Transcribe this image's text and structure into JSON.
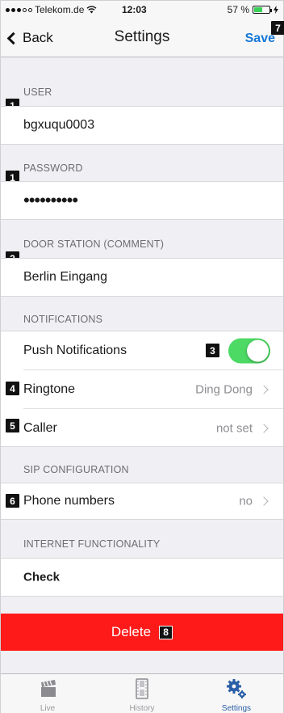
{
  "status_bar": {
    "carrier": "Telekom.de",
    "time": "12:03",
    "battery_text": "57 %",
    "battery_level": 0.57
  },
  "nav": {
    "back_label": "Back",
    "title": "Settings",
    "save_label": "Save"
  },
  "sections": {
    "user": {
      "header": "USER",
      "value": "bgxuqu0003",
      "badge": "1"
    },
    "password": {
      "header": "PASSWORD",
      "masked": "••••••••••",
      "badge": "1"
    },
    "door_station": {
      "header": "DOOR STATION (COMMENT)",
      "value": "Berlin Eingang",
      "badge": "2"
    },
    "notifications": {
      "header": "NOTIFICATIONS",
      "push": {
        "label": "Push Notifications",
        "enabled": true,
        "badge": "3"
      },
      "ringtone": {
        "label": "Ringtone",
        "value": "Ding Dong",
        "badge": "4"
      },
      "caller": {
        "label": "Caller",
        "value": "not set",
        "badge": "5"
      }
    },
    "sip": {
      "header": "SIP CONFIGURATION",
      "phone_numbers": {
        "label": "Phone numbers",
        "value": "no",
        "badge": "6"
      }
    },
    "internet": {
      "header": "INTERNET FUNCTIONALITY",
      "check_label": "Check"
    }
  },
  "delete": {
    "label": "Delete",
    "badge": "8"
  },
  "save_badge": "7",
  "tabs": [
    {
      "label": "Live",
      "icon": "clapperboard-icon"
    },
    {
      "label": "History",
      "icon": "film-icon"
    },
    {
      "label": "Settings",
      "icon": "gears-icon"
    }
  ],
  "colors": {
    "accent": "#1579d8",
    "toggle_on": "#4cd964",
    "delete": "#ff1a1a",
    "active_tab": "#2a5fa8"
  }
}
